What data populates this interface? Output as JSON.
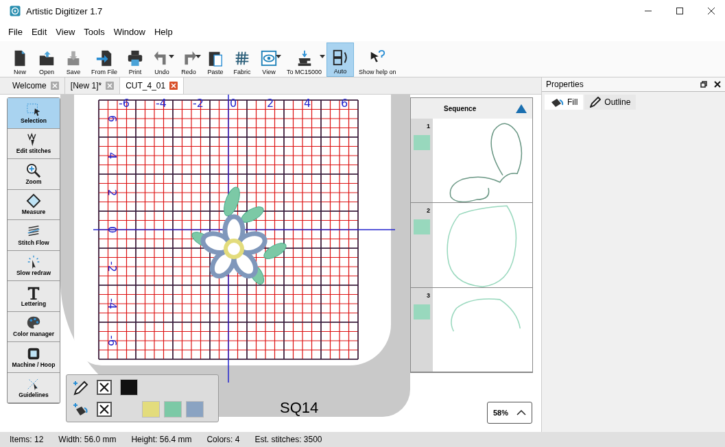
{
  "window": {
    "title": "Artistic Digitizer 1.7"
  },
  "menu": [
    "File",
    "Edit",
    "View",
    "Tools",
    "Window",
    "Help"
  ],
  "toolbar": [
    {
      "kind": "new",
      "label": "New",
      "active": false,
      "dropdown": false
    },
    {
      "kind": "open",
      "label": "Open",
      "active": false,
      "dropdown": false
    },
    {
      "kind": "save",
      "label": "Save",
      "active": false,
      "dropdown": false
    },
    {
      "kind": "fromfile",
      "label": "From File",
      "active": false,
      "dropdown": false
    },
    {
      "kind": "print",
      "label": "Print",
      "active": false,
      "dropdown": false
    },
    {
      "kind": "undo",
      "label": "Undo",
      "active": false,
      "dropdown": true
    },
    {
      "kind": "redo",
      "label": "Redo",
      "active": false,
      "dropdown": true
    },
    {
      "kind": "paste",
      "label": "Paste",
      "active": false,
      "dropdown": false
    },
    {
      "kind": "fabric",
      "label": "Fabric",
      "active": false,
      "dropdown": false
    },
    {
      "kind": "view",
      "label": "View",
      "active": false,
      "dropdown": true
    },
    {
      "kind": "machine",
      "label": "To MC15000",
      "active": false,
      "dropdown": true
    },
    {
      "kind": "auto",
      "label": "Auto",
      "active": true,
      "dropdown": false
    },
    {
      "kind": "help",
      "label": "Show help on",
      "active": false,
      "dropdown": false
    }
  ],
  "tabs": [
    {
      "label": "Welcome",
      "selected": false
    },
    {
      "label": "[New 1]*",
      "selected": false
    },
    {
      "label": "CUT_4_01",
      "selected": true
    }
  ],
  "tools": [
    {
      "kind": "selection",
      "label": "Selection",
      "selected": true
    },
    {
      "kind": "edit",
      "label": "Edit stitches",
      "selected": false
    },
    {
      "kind": "zoom",
      "label": "Zoom",
      "selected": false
    },
    {
      "kind": "measure",
      "label": "Measure",
      "selected": false
    },
    {
      "kind": "flow",
      "label": "Stitch Flow",
      "selected": false
    },
    {
      "kind": "slow",
      "label": "Slow redraw",
      "selected": false
    },
    {
      "kind": "lettering",
      "label": "Lettering",
      "selected": false
    },
    {
      "kind": "color",
      "label": "Color manager",
      "selected": false
    },
    {
      "kind": "hoop",
      "label": "Machine / Hoop",
      "selected": false
    },
    {
      "kind": "guide",
      "label": "Guidelines",
      "selected": false
    }
  ],
  "ruler": {
    "x_labels": [
      "-6",
      "-4",
      "-2",
      "0",
      "2",
      "4",
      "6"
    ],
    "y_labels": [
      "6",
      "4",
      "2",
      "0",
      "-2",
      "-4",
      "-6"
    ]
  },
  "hoop": {
    "label": "SQ14"
  },
  "palette": {
    "outline_none": {
      "checked": true
    },
    "outline_colors": [
      {
        "color": "#111111"
      }
    ],
    "fill_none": {
      "checked": true
    },
    "fill_colors": [
      {
        "color": "#e3dc7c"
      },
      {
        "color": "#7cc9a6"
      },
      {
        "color": "#8aa3c2"
      }
    ]
  },
  "zoom": {
    "value": "58%"
  },
  "sequence": {
    "title": "Sequence",
    "items": [
      {
        "number": "1",
        "color": "#98d8bd"
      },
      {
        "number": "2",
        "color": "#98d8bd"
      },
      {
        "number": "3",
        "color": "#98d8bd"
      }
    ]
  },
  "properties": {
    "title": "Properties",
    "tabs": [
      {
        "label": "Fill",
        "selected": true
      },
      {
        "label": "Outline",
        "selected": false
      }
    ]
  },
  "status_bar": [
    "Items: 12",
    "Width: 56.0 mm",
    "Height: 56.4 mm",
    "Colors: 4",
    "Est. stitches: 3500"
  ]
}
